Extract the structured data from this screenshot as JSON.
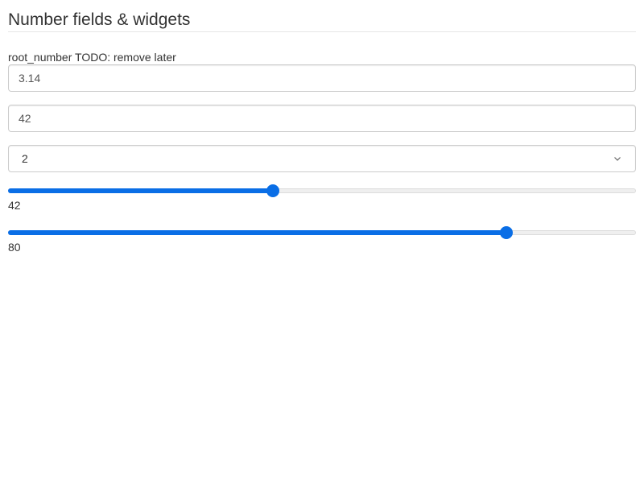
{
  "legend": "Number fields & widgets",
  "number_field": {
    "label": "root_number TODO: remove later",
    "value": "3.14"
  },
  "integer_field": {
    "value": "42"
  },
  "select_field": {
    "selected": "2",
    "icon": "chevron-down-icon"
  },
  "range_1": {
    "value": "42",
    "fraction": 0.42
  },
  "range_2": {
    "value": "80",
    "fraction": 0.8
  },
  "colors": {
    "accent": "#0a6ee6",
    "track": "#efefef"
  }
}
